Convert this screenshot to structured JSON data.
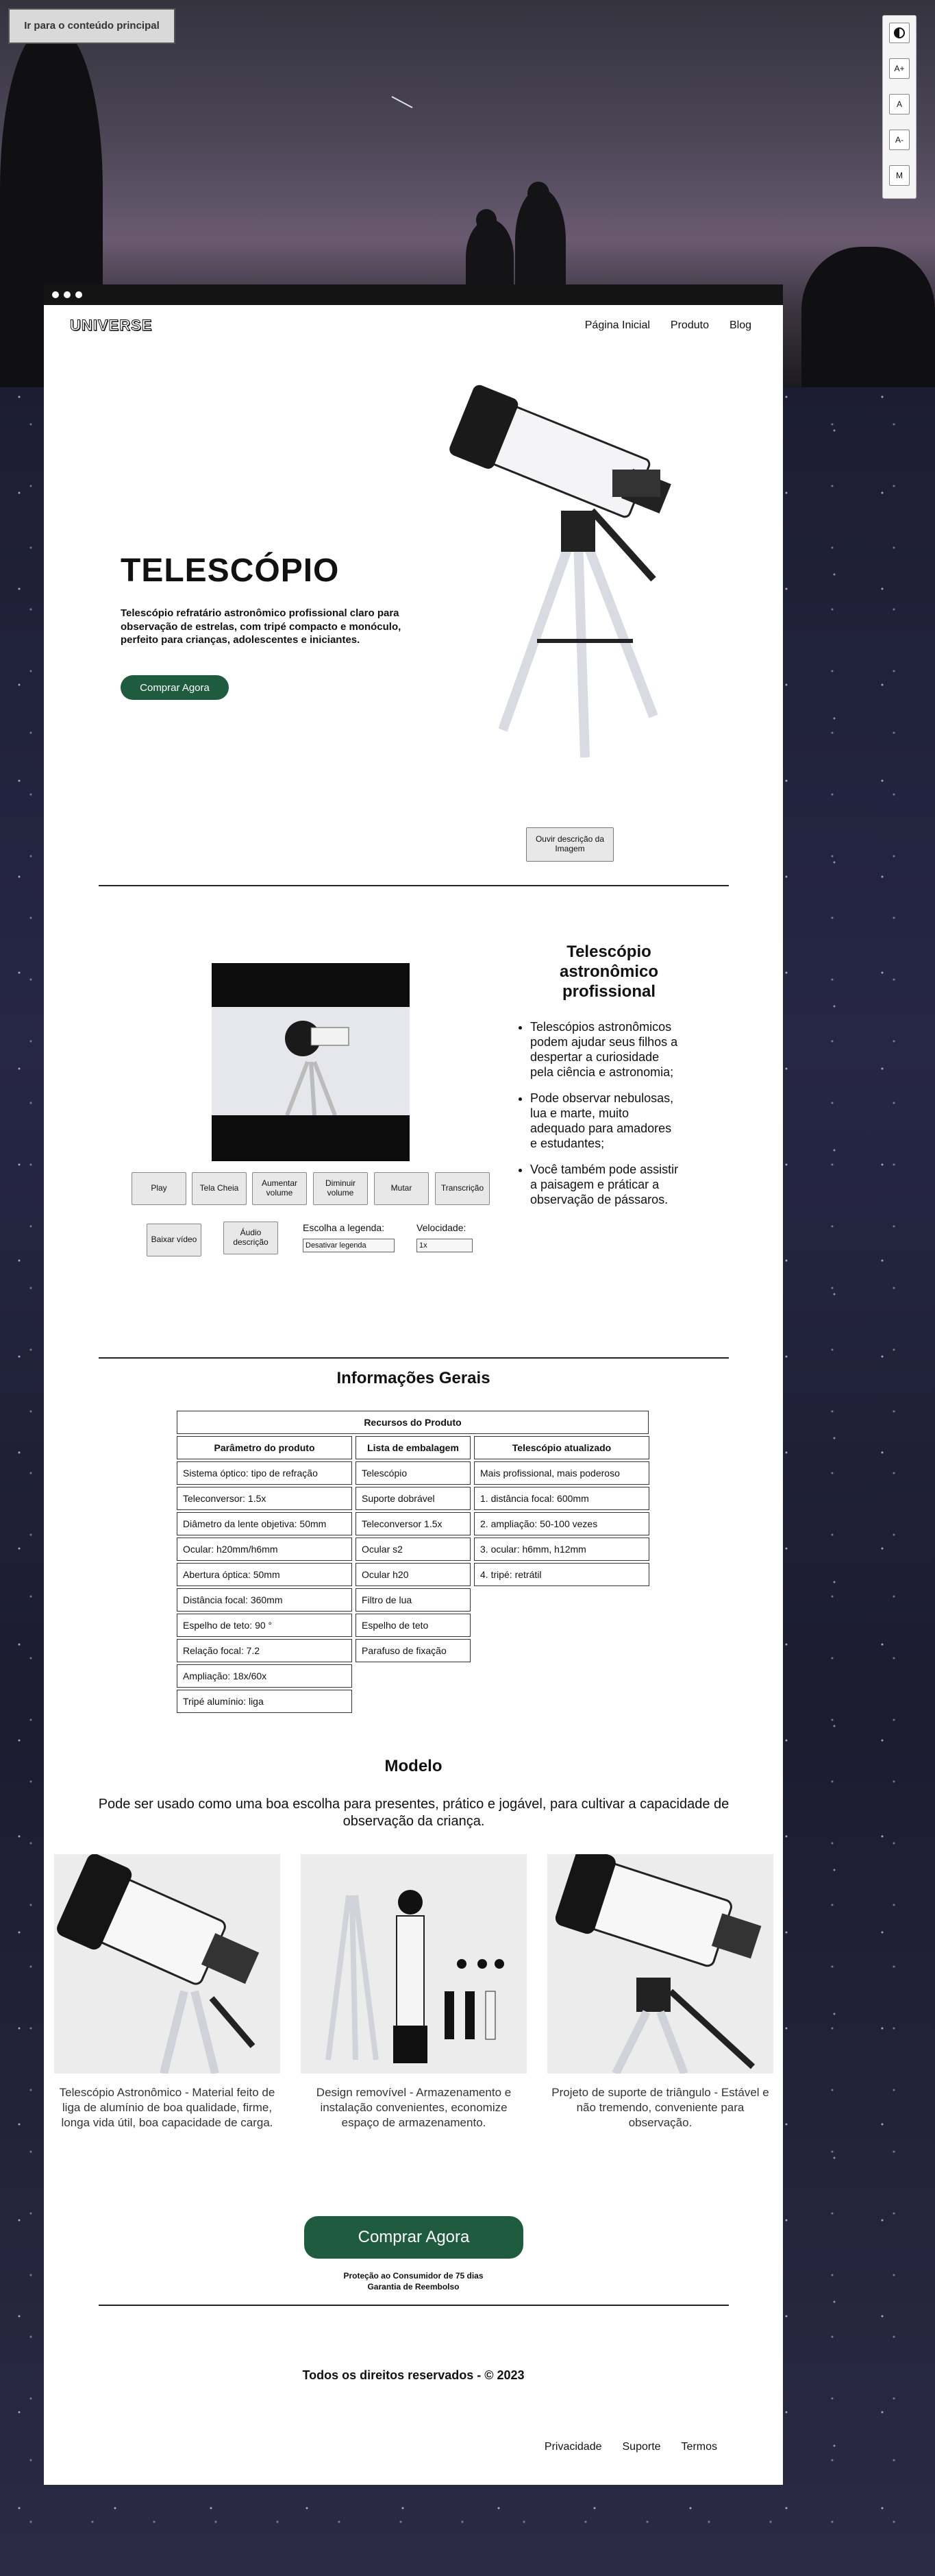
{
  "skip_link": "Ir para o conteúdo principal",
  "accessibility": {
    "contrast_icon": "contrast-icon",
    "increase": "A+",
    "normal": "A",
    "decrease": "A-",
    "mono": "M"
  },
  "brand": {
    "logo": "UNIVERSE"
  },
  "nav": {
    "items": [
      "Página Inicial",
      "Produto",
      "Blog"
    ]
  },
  "hero": {
    "title": "TELESCÓPIO",
    "description": "Telescópio refratário astronômico profissional claro para observação de estrelas, com tripé compacto e monóculo, perfeito para crianças, adolescentes e iniciantes.",
    "cta": "Comprar Agora",
    "audio_description": "Ouvir descrição da Imagem"
  },
  "video": {
    "buttons": [
      "Play",
      "Tela Cheia",
      "Aumentar volume",
      "Diminuir volume",
      "Mutar",
      "Transcrição"
    ],
    "download": "Baixar vídeo",
    "audio_description": "Áudio descrição",
    "subtitle_label": "Escolha a legenda:",
    "subtitle_value": "Desativar legenda",
    "speed_label": "Velocidade:",
    "speed_value": "1x"
  },
  "features": {
    "title": "Telescópio astronômico profissional",
    "items": [
      "Telescópios astronômicos podem ajudar seus filhos a despertar a curiosidade pela ciência e astronomia;",
      "Pode observar nebulosas, lua e marte, muito adequado para amadores e estudantes;",
      "Você também pode assistir a paisagem e práticar a observação de pássaros."
    ]
  },
  "info": {
    "title": "Informações Gerais",
    "caption": "Recursos do Produto",
    "headers": [
      "Parâmetro do produto",
      "Lista de embalagem",
      "Telescópio atualizado"
    ],
    "col1": [
      "Sistema óptico: tipo de refração",
      "Teleconversor: 1.5x",
      "Diâmetro da lente objetiva: 50mm",
      "Ocular: h20mm/h6mm",
      "Abertura óptica: 50mm",
      "Distância focal: 360mm",
      "Espelho de teto: 90 °",
      "Relação focal: 7.2",
      "Ampliação: 18x/60x",
      "Tripé alumínio: liga"
    ],
    "col2": [
      "Telescópio",
      "Suporte dobrável",
      "Teleconversor 1.5x",
      "Ocular s2",
      "Ocular h20",
      "Filtro de lua",
      "Espelho de teto",
      "Parafuso de fixação"
    ],
    "col3": [
      "Mais profissional, mais poderoso",
      "1. distância focal: 600mm",
      "2. ampliação: 50-100 vezes",
      "3. ocular: h6mm, h12mm",
      "4. tripé: retrátil"
    ]
  },
  "model": {
    "title": "Modelo",
    "subtitle": "Pode ser usado como uma boa escolha para presentes, prático e jogável, para cultivar a capacidade de observação da criança.",
    "products": [
      "Telescópio Astronômico - Material feito de liga de alumínio de boa qualidade, firme, longa vida útil, boa capacidade de carga.",
      "Design removível - Armazenamento e instalação convenientes, economize espaço de armazenamento.",
      "Projeto de suporte de triângulo - Estável e não tremendo, conveniente para observação."
    ]
  },
  "purchase": {
    "cta": "Comprar Agora",
    "guarantee_1": "Proteção ao Consumidor de 75 dias",
    "guarantee_2": "Garantia de Reembolso"
  },
  "footer": {
    "rights": "Todos os direitos reservados - © 2023",
    "links": [
      "Privacidade",
      "Suporte",
      "Termos"
    ]
  }
}
